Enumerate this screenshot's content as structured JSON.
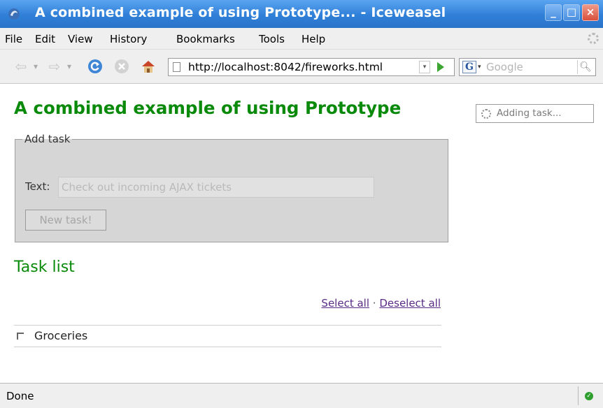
{
  "window": {
    "title": "A combined example of using Prototype... - Iceweasel",
    "minimize": "_",
    "maximize": "□",
    "close": "×"
  },
  "menu": [
    "File",
    "Edit",
    "View",
    "History",
    "Bookmarks",
    "Tools",
    "Help"
  ],
  "toolbar": {
    "url": "http://localhost:8042/fireworks.html",
    "search_placeholder": "Google",
    "search_engine": "G"
  },
  "page": {
    "title": "A combined example of using Prototype",
    "status_indicator": "Adding task...",
    "add_task": {
      "legend": "Add task",
      "text_label": "Text:",
      "text_placeholder": "Check out incoming AJAX tickets",
      "button_label": "New task!"
    },
    "task_list": {
      "heading": "Task list",
      "select_all": "Select all",
      "separator": "·",
      "deselect_all": "Deselect all",
      "items": [
        {
          "label": "Groceries",
          "checked": false
        }
      ]
    }
  },
  "statusbar": {
    "text": "Done"
  },
  "colors": {
    "heading_green": "#0a8a0a",
    "titlebar_blue": "#2f7fd8",
    "link_purple": "#5a2b86"
  },
  "icons": {
    "back": "back-arrow-icon",
    "forward": "forward-arrow-icon",
    "reload": "reload-icon",
    "stop": "stop-icon",
    "home": "home-icon",
    "page": "page-icon",
    "go": "go-arrow-icon",
    "search": "magnifier-icon",
    "spinner": "spinner-icon",
    "status_ok": "check-circle-icon"
  }
}
